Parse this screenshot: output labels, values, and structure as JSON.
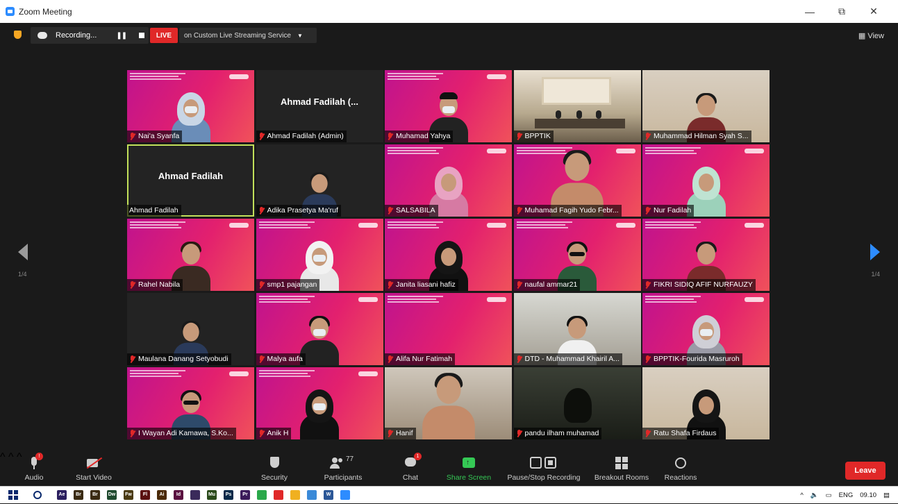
{
  "window": {
    "title": "Zoom Meeting",
    "controls": [
      "—",
      "⧉",
      "✕"
    ]
  },
  "topbar": {
    "recording_label": "Recording...",
    "live_label": "LIVE",
    "stream_label": "on Custom Live Streaming Service",
    "view_label": "View"
  },
  "tiles": [
    {
      "name": "Nai'a Syanfa",
      "bg": "pink",
      "style": "hijab-mask"
    },
    {
      "name": "Ahmad Fadilah (Admin)",
      "bg": "black",
      "center": "Ahmad Fadilah (..."
    },
    {
      "name": "Muhamad Yahya",
      "bg": "pink",
      "style": "hat-mask"
    },
    {
      "name": "BPPTIK",
      "bg": "room",
      "style": "room"
    },
    {
      "name": "Muhammad Hilman Syah S...",
      "bg": "wall",
      "style": "boy"
    },
    {
      "name": "Ahmad Fadilah",
      "bg": "black",
      "center": "Ahmad Fadilah",
      "active": true,
      "nomute": true
    },
    {
      "name": "Adika Prasetya Ma'ruf",
      "bg": "black",
      "style": "boy-small"
    },
    {
      "name": "SALSABILA",
      "bg": "pink",
      "style": "hijab-pink"
    },
    {
      "name": "Muhamad Fagih Yudo Febr...",
      "bg": "pink",
      "style": "boy-big"
    },
    {
      "name": "Nur Fadilah",
      "bg": "pink",
      "style": "hijab-mint"
    },
    {
      "name": "Rahel Nabila",
      "bg": "pink",
      "style": "girl"
    },
    {
      "name": "smp1 pajangan",
      "bg": "pink",
      "style": "hijab-white-mask"
    },
    {
      "name": "Janita liasani hafiz",
      "bg": "pink",
      "style": "hijab-black"
    },
    {
      "name": "naufal ammar21",
      "bg": "pink",
      "style": "boy-glasses"
    },
    {
      "name": "FIKRI SIDIQ AFIF NURFAUZY",
      "bg": "pink",
      "style": "boy"
    },
    {
      "name": "Maulana Danang Setyobudi",
      "bg": "black",
      "style": "boy-small"
    },
    {
      "name": "Malya aufa",
      "bg": "pink",
      "style": "girl-mask"
    },
    {
      "name": "Alifa Nur Fatimah",
      "bg": "pink",
      "style": "none"
    },
    {
      "name": "DTD - Muhammad Khairil A...",
      "bg": "outdoor",
      "style": "boy-white"
    },
    {
      "name": "BPPTIK-Fourida Masruroh",
      "bg": "pink",
      "style": "hijab-grey-mask"
    },
    {
      "name": "I Wayan Adi Kamawa, S.Ko...",
      "bg": "pink",
      "style": "boy-headset"
    },
    {
      "name": "Anik H",
      "bg": "pink",
      "style": "hijab-black-mask"
    },
    {
      "name": "Hanif",
      "bg": "bed",
      "style": "boy-big"
    },
    {
      "name": "pandu ilham muhamad",
      "bg": "dark",
      "style": "shadow"
    },
    {
      "name": "Ratu Shafa Firdaus",
      "bg": "wall",
      "style": "hijab-black"
    }
  ],
  "pagination": {
    "left": "1/4",
    "right": "1/4"
  },
  "toolbar": {
    "audio": "Audio",
    "start_video": "Start Video",
    "security": "Security",
    "participants": "Participants",
    "participants_count": "77",
    "chat": "Chat",
    "chat_badge": "1",
    "audio_badge": "!",
    "share_screen": "Share Screen",
    "pause_stop_recording": "Pause/Stop Recording",
    "breakout_rooms": "Breakout Rooms",
    "reactions": "Reactions",
    "leave": "Leave"
  },
  "taskbar": {
    "apps": [
      {
        "label": "Ae",
        "color": "#2b1f5f"
      },
      {
        "label": "Br",
        "color": "#3a2a12"
      },
      {
        "label": "Br",
        "color": "#3a2a12"
      },
      {
        "label": "Dw",
        "color": "#1f4a2e"
      },
      {
        "label": "Fw",
        "color": "#4a3a12"
      },
      {
        "label": "Fl",
        "color": "#5a1010"
      },
      {
        "label": "Ai",
        "color": "#4a2a08"
      },
      {
        "label": "Id",
        "color": "#5a1040"
      },
      {
        "label": "",
        "color": "#3a2a5a"
      },
      {
        "label": "Mu",
        "color": "#2a4a1a"
      },
      {
        "label": "Ps",
        "color": "#0a2a4a"
      },
      {
        "label": "Pr",
        "color": "#3a1a5a"
      },
      {
        "label": "",
        "color": "#2aa84a"
      },
      {
        "label": "",
        "color": "#e02828"
      },
      {
        "label": "",
        "color": "#f0b020"
      },
      {
        "label": "",
        "color": "#3a8ad8"
      },
      {
        "label": "W",
        "color": "#2b5797"
      },
      {
        "label": "",
        "color": "#2d8cff"
      }
    ],
    "lang": "ENG",
    "time": "09.10"
  }
}
